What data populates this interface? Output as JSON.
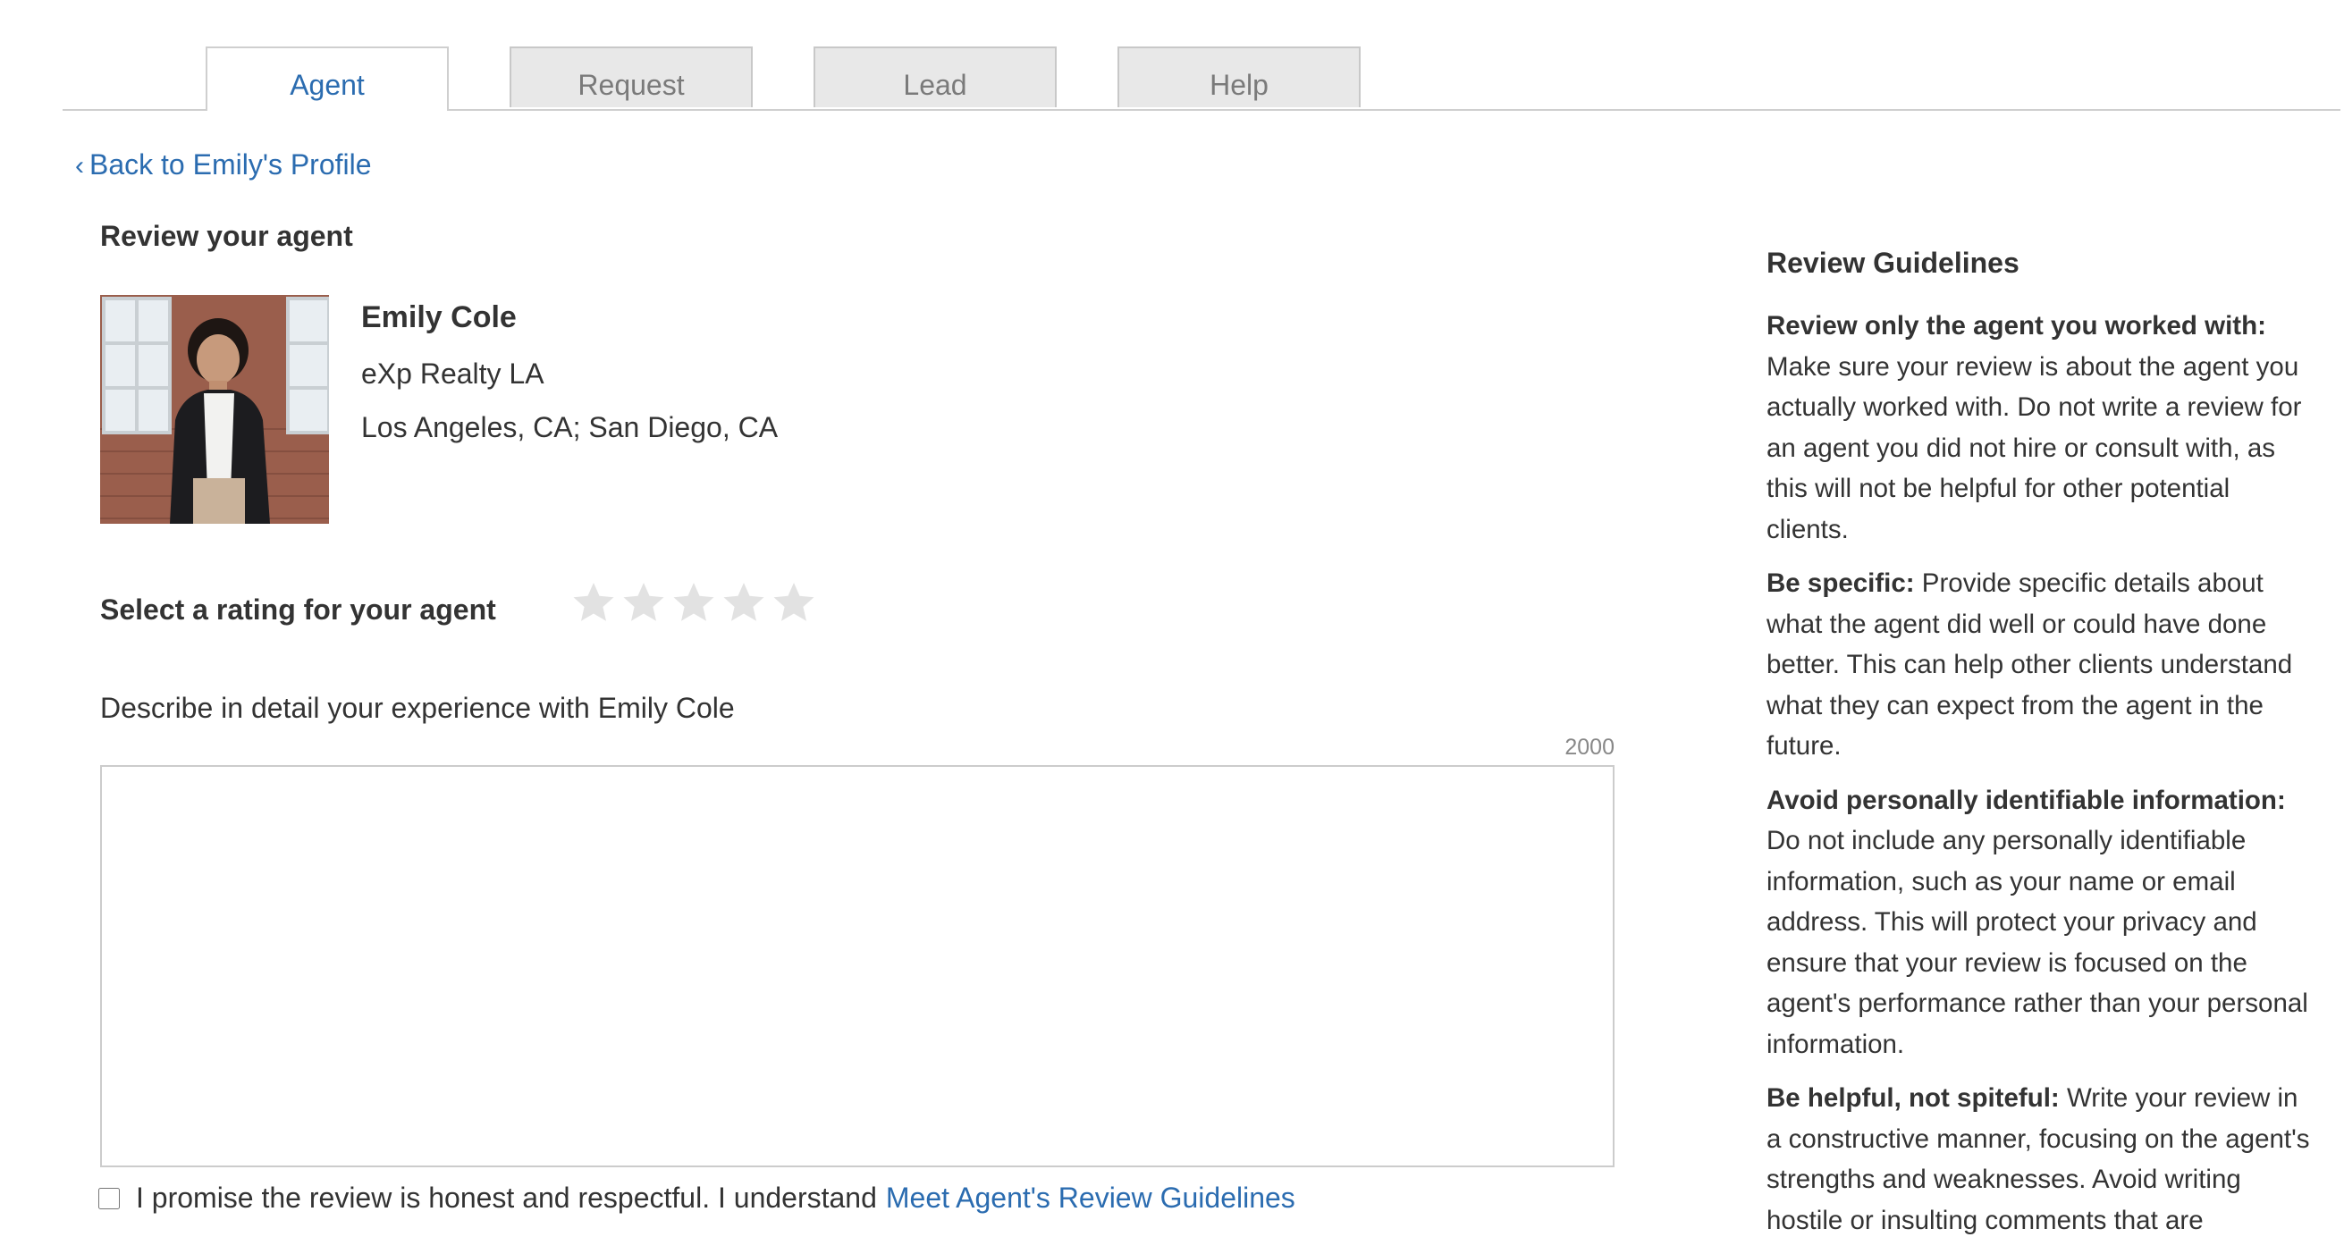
{
  "tabs": [
    {
      "label": "Agent",
      "active": true
    },
    {
      "label": "Request",
      "active": false
    },
    {
      "label": "Lead",
      "active": false
    },
    {
      "label": "Help",
      "active": false
    }
  ],
  "back_link": "Back to Emily's Profile",
  "section_title": "Review your agent",
  "agent": {
    "name": "Emily Cole",
    "brokerage": "eXp Realty LA",
    "locations": "Los Angeles, CA; San Diego, CA"
  },
  "rating": {
    "label": "Select a rating for your agent",
    "max": 5,
    "value": 0,
    "star_empty_color": "#e2e2e2"
  },
  "description": {
    "label": "Describe in detail your experience with Emily Cole",
    "char_limit": "2000",
    "value": ""
  },
  "promise": {
    "text": "I promise the review is honest and respectful. I understand",
    "link": "Meet Agent's Review Guidelines",
    "checked": false
  },
  "guidelines": {
    "title": "Review Guidelines",
    "items": [
      {
        "heading": "Review only the agent you worked with:",
        "body": "Make sure your review is about the agent you actually worked with. Do not write a review for an agent you did not hire or consult with, as this will not be helpful for other potential clients."
      },
      {
        "heading": "Be specific:",
        "body": "Provide specific details about what the agent did well or could have done better. This can help other clients understand what they can expect from the agent in the future."
      },
      {
        "heading": "Avoid personally identifiable information:",
        "body": "Do not include any personally identifiable information, such as your name or email address. This will protect your privacy and ensure that your review is focused on the agent's performance rather than your personal information."
      },
      {
        "heading": "Be helpful, not spiteful:",
        "body": "Write your review in a constructive manner, focusing on the agent's strengths and weaknesses. Avoid writing hostile or insulting comments that are"
      }
    ]
  },
  "colors": {
    "link": "#2b6cb0",
    "tab_inactive_bg": "#e8e8e8"
  }
}
